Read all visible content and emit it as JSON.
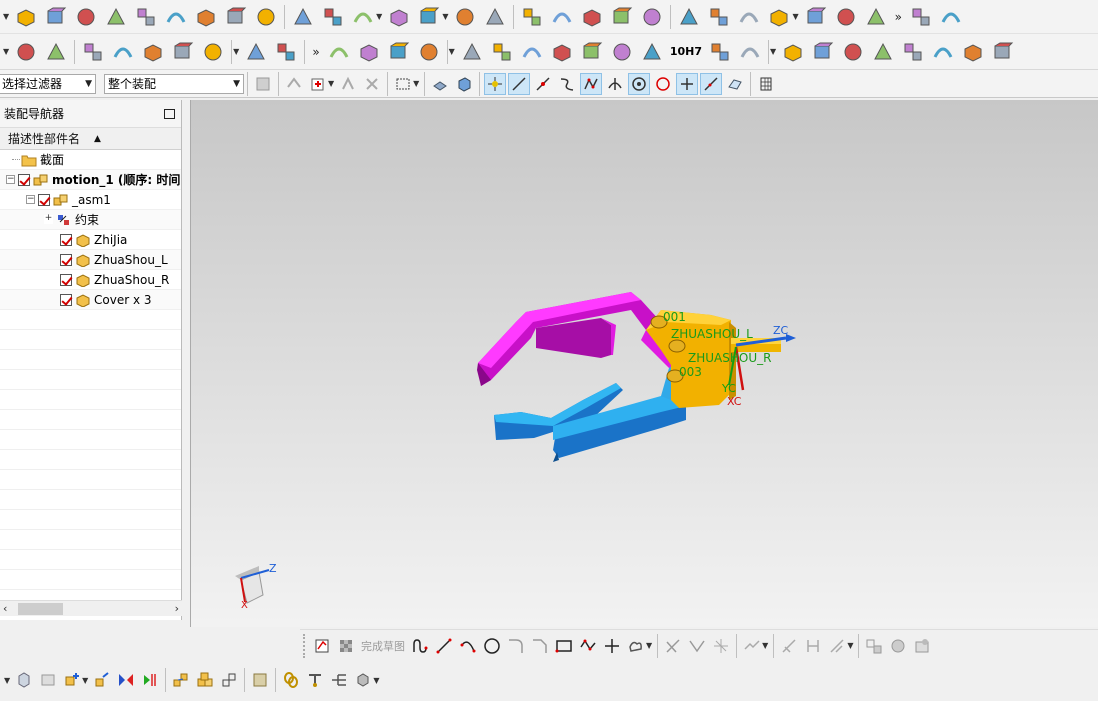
{
  "toolbar_row1": {
    "icons": [
      "part-icon",
      "shell-icon",
      "block-icon",
      "cylinder-icon",
      "edge-blend-icon",
      "chamfer-icon",
      "extrude-icon",
      "pattern-icon",
      "array-icon",
      "boolean-icon",
      "sketch-icon",
      "feature-icon",
      "body-icon",
      "sweep-icon",
      "trim-icon",
      "unite-icon",
      "subtract-icon",
      "intersect-icon",
      "offset-face-icon",
      "draft-icon",
      "shell-body-icon",
      "scale-icon",
      "mirror-icon",
      "surface-icon",
      "mesh-icon",
      "swept-icon",
      "through-curves-icon",
      "studio-icon",
      "styled-icon",
      "close-icon"
    ],
    "more_label": "»"
  },
  "toolbar_row2": {
    "icons": [
      "layers-icon",
      "stack-icon",
      "note-icon",
      "assembly-add-icon",
      "assembly-move-icon",
      "assembly-constraint-icon",
      "abc-component-icon",
      "wave-icon",
      "deform-icon",
      "spring-cyl-icon",
      "spring-icon",
      "washer-icon",
      "bearing-icon",
      "triangle-icon",
      "table-icon",
      "grid-constraint-icon",
      "joint-icon",
      "sheet-icon",
      "brush-icon",
      "measure-icon",
      "assembly-cubes-icon",
      "assembly-cubes-2-icon",
      "line-icon",
      "arc-icon",
      "polyline-icon",
      "heart-curve-icon",
      "project-icon",
      "intersection-curve-icon",
      "offset-curve-icon",
      "bridge-icon"
    ],
    "tolerance_label": "10H7",
    "more_label": "»"
  },
  "toolbar_row3": {
    "filter_select": "选择过滤器",
    "scope_select": "整个装配"
  },
  "navigator": {
    "title": "装配导航器",
    "column_header": "描述性部件名",
    "items": [
      {
        "label": "截面",
        "level": 1
      },
      {
        "label": "motion_1 (顺序: 时间",
        "level": 0
      },
      {
        "label": "_asm1",
        "level": 1
      },
      {
        "label": "约束",
        "level": 2
      },
      {
        "label": "ZhiJia",
        "level": 2
      },
      {
        "label": "ZhuaShou_L",
        "level": 2
      },
      {
        "label": "ZhuaShou_R",
        "level": 2
      },
      {
        "label": "Cover x 3",
        "level": 2
      }
    ]
  },
  "viewport": {
    "labels": {
      "j001": "001",
      "zhuashou_l": "ZHUASHOU_L",
      "zhuashou_r": "ZHUASHOU_R",
      "j003": "003",
      "zc": "ZC",
      "yc": "YC",
      "xc": "XC",
      "triad_z": "Z",
      "triad_x": "X"
    },
    "colors": {
      "magenta": "#e515e5",
      "cyan": "#1aa6e6",
      "orange": "#f2b100",
      "axis_blue": "#1f5fd6",
      "axis_red": "#d01010",
      "axis_green": "#12a012",
      "label_green": "#1a9a1a"
    }
  },
  "bottom_toolbar_1": {
    "finish_sketch": "完成草图"
  },
  "bottom_toolbar_2": {}
}
